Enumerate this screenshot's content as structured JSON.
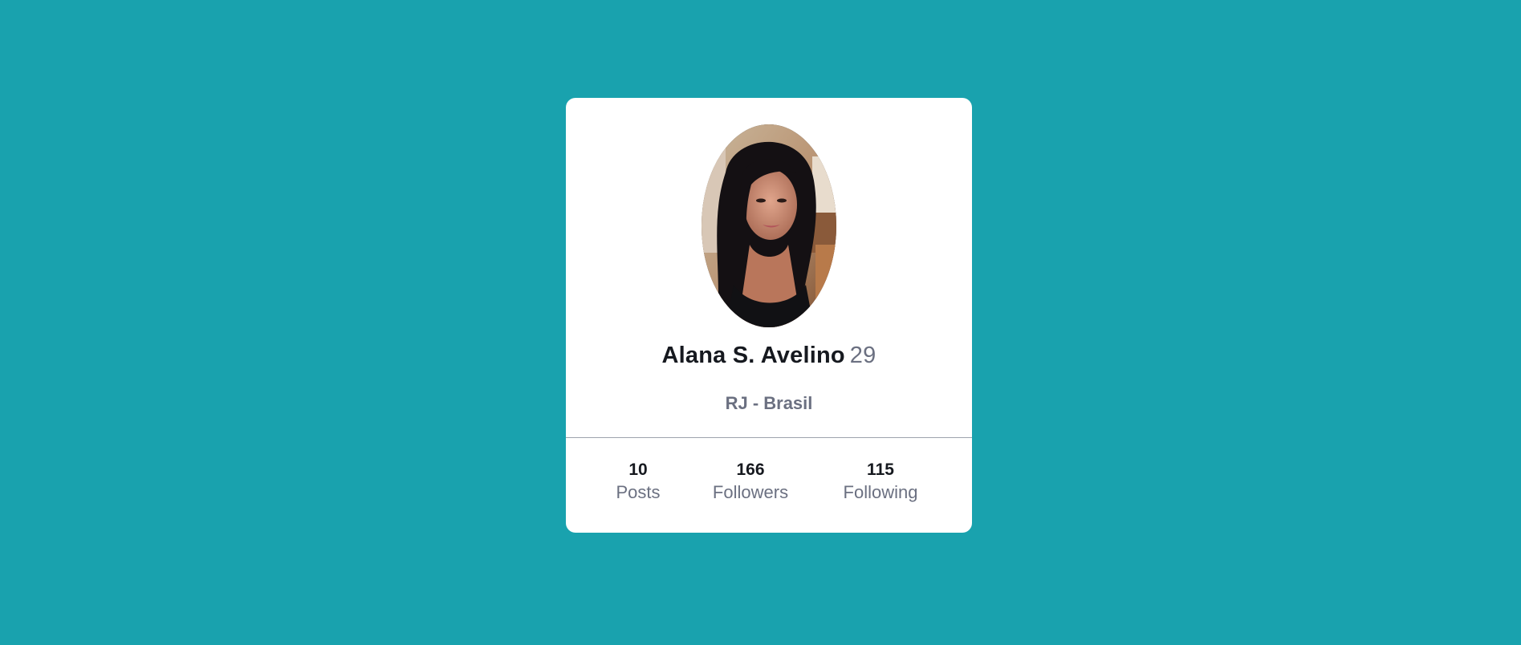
{
  "profile": {
    "name": "Alana S. Avelino",
    "age": "29",
    "location": "RJ - Brasil",
    "avatar_icon": "profile-photo"
  },
  "stats": [
    {
      "value": "10",
      "label": "Posts"
    },
    {
      "value": "166",
      "label": "Followers"
    },
    {
      "value": "115",
      "label": "Following"
    }
  ],
  "colors": {
    "background": "#19a2ae",
    "card": "#ffffff",
    "name": "#16191f",
    "muted": "#6b7081"
  }
}
